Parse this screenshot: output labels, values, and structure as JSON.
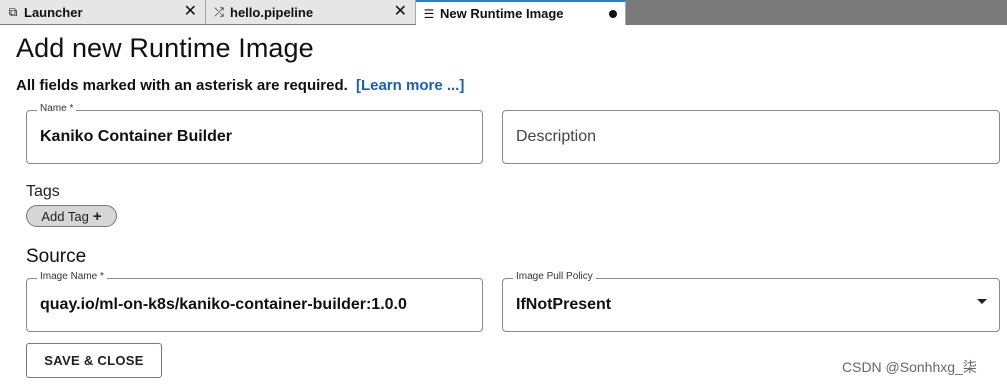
{
  "tabs": [
    {
      "icon": "launcher-icon",
      "glyph": "⧉",
      "label": "Launcher",
      "close": "✕"
    },
    {
      "icon": "pipeline-icon",
      "glyph": "⤮",
      "label": "hello.pipeline",
      "close": "✕"
    },
    {
      "icon": "document-icon",
      "glyph": "☰",
      "label": "New Runtime Image"
    }
  ],
  "page": {
    "title": "Add new Runtime Image",
    "required_note": "All fields marked with an asterisk are required.",
    "learn_more": "[Learn more ...]"
  },
  "name_field": {
    "legend": "Name *",
    "value": "Kaniko Container Builder"
  },
  "description_field": {
    "placeholder": "Description"
  },
  "tags": {
    "label": "Tags",
    "add_label": "Add Tag",
    "add_icon": "+"
  },
  "source": {
    "heading": "Source"
  },
  "image_name_field": {
    "legend": "Image Name *",
    "value": "quay.io/ml-on-k8s/kaniko-container-builder:1.0.0"
  },
  "pull_policy_field": {
    "legend": "Image Pull Policy",
    "value": "IfNotPresent"
  },
  "actions": {
    "save_close": "SAVE & CLOSE"
  },
  "watermark": "CSDN @Sonhhxg_柒",
  "colors": {
    "link": "#1a5fb4",
    "tabbar": "#7a7a7a",
    "active_tab_accent": "#2b7cd3"
  }
}
